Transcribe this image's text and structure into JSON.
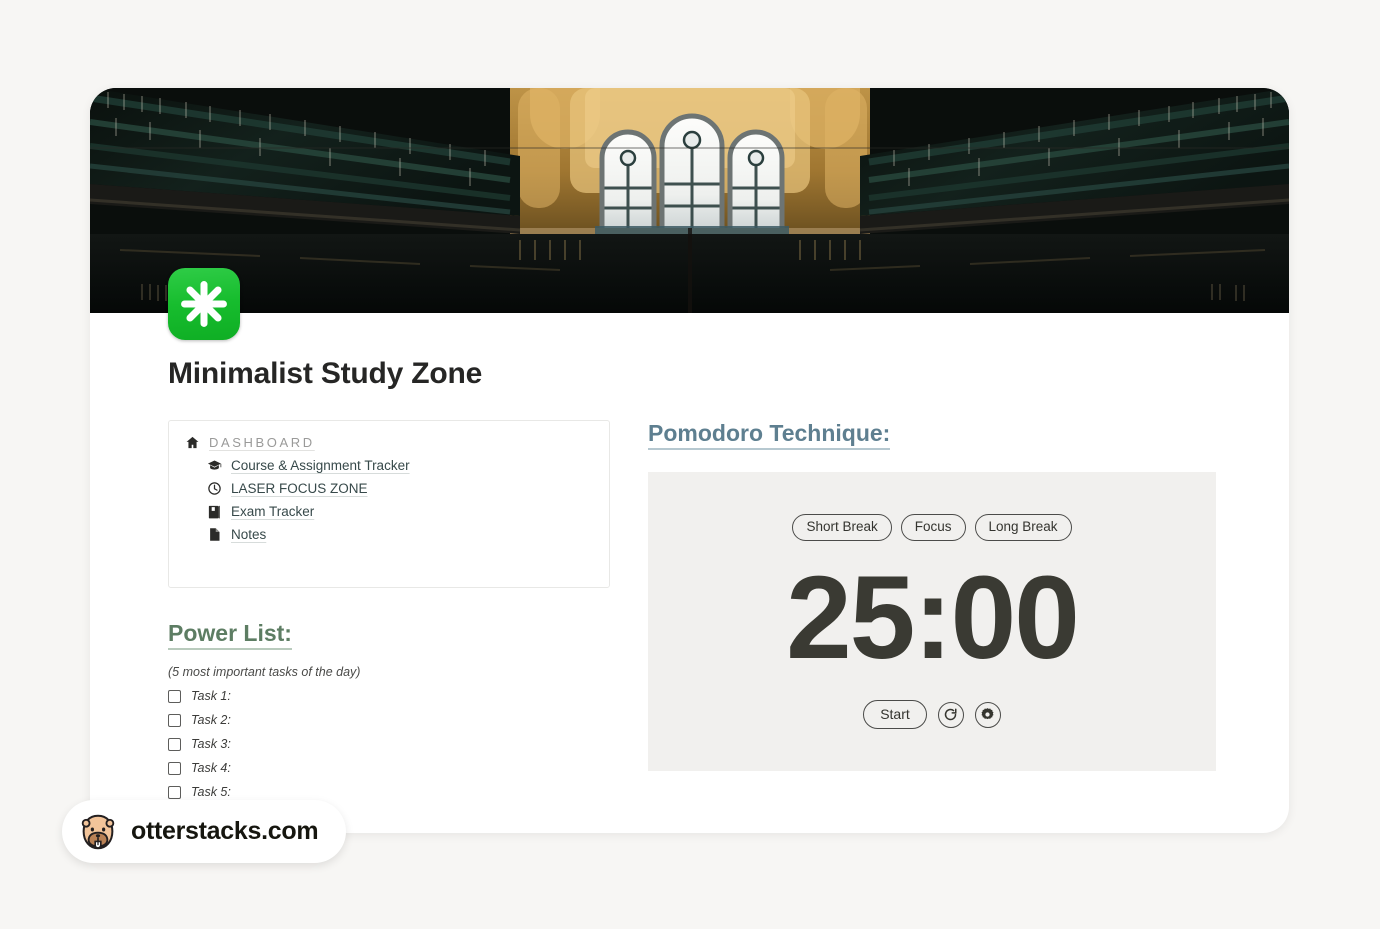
{
  "page": {
    "background_color": "#f7f6f4",
    "card_background": "#ffffff"
  },
  "cover": {
    "name": "library-interior-photo",
    "alt": "Dark library interior with tall bookshelves, warm golden arches and gothic arched windows"
  },
  "header": {
    "logo_icon": "green-asterisk-logo",
    "logo_color": "#17bd2e",
    "title": "Minimalist Study Zone"
  },
  "nav_card": {
    "items": [
      {
        "icon": "home-icon",
        "label": "DASHBOARD",
        "style": "dashboard"
      },
      {
        "icon": "graduation-cap-icon",
        "label": "Course & Assignment Tracker",
        "style": "sub"
      },
      {
        "icon": "clock-icon",
        "label": "LASER FOCUS ZONE",
        "style": "sub"
      },
      {
        "icon": "book-icon",
        "label": "Exam Tracker",
        "style": "sub"
      },
      {
        "icon": "document-icon",
        "label": "Notes",
        "style": "sub"
      }
    ]
  },
  "power_list": {
    "heading": "Power List:",
    "heading_color": "#5d7d63",
    "subtitle": "(5 most important tasks of the day)",
    "tasks": [
      {
        "label": "Task 1:",
        "checked": false
      },
      {
        "label": "Task 2:",
        "checked": false
      },
      {
        "label": "Task 3:",
        "checked": false
      },
      {
        "label": "Task 4:",
        "checked": false
      },
      {
        "label": "Task 5:",
        "checked": false
      }
    ]
  },
  "pomodoro": {
    "heading": "Pomodoro Technique:",
    "heading_color": "#5e7f90",
    "panel_color": "#f1f0ee",
    "modes": [
      {
        "label": "Short Break",
        "active": false
      },
      {
        "label": "Focus",
        "active": false
      },
      {
        "label": "Long Break",
        "active": false
      }
    ],
    "time_display": "25:00",
    "controls": {
      "start_label": "Start",
      "reset_icon": "refresh-icon",
      "settings_icon": "gear-icon"
    }
  },
  "watermark": {
    "logo_icon": "otter-face-logo",
    "text": "otterstacks.com"
  }
}
